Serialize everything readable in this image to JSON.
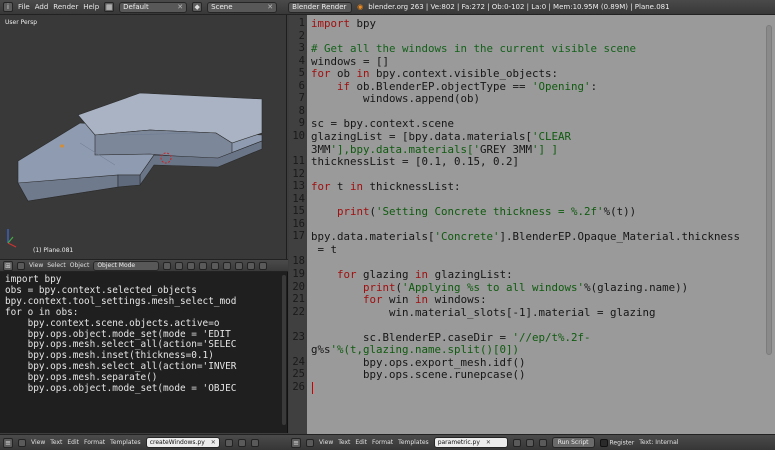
{
  "topbar": {
    "menu": [
      "File",
      "Add",
      "Render",
      "Help"
    ],
    "layout": "Default",
    "scene": "Scene",
    "engine": "Blender Render",
    "stats": "blender.org 263 | Ve:802 | Fa:272 | Ob:0-102 | La:0 | Mem:10.95M (0.89M) | Plane.081"
  },
  "viewport": {
    "title": "User Persp",
    "object_label": "(1) Plane.081",
    "header": {
      "menu": [
        "View",
        "Select",
        "Object"
      ],
      "mode": "Object Mode"
    }
  },
  "console": {
    "lines": [
      "import bpy",
      "obs = bpy.context.selected_objects",
      "bpy.context.tool_settings.mesh_select_mod",
      "for o in obs:",
      "    bpy.context.scene.objects.active=o",
      "    bpy.ops.object.mode_set(mode = 'EDIT",
      "    bpy.ops.mesh.select_all(action='SELEC",
      "    bpy.ops.mesh.inset(thickness=0.1)",
      "    bpy.ops.mesh.select_all(action='INVER",
      "    bpy.ops.mesh.separate()",
      "    bpy.ops.object.mode_set(mode = 'OBJEC"
    ]
  },
  "left_bottom": {
    "menu": [
      "View",
      "Text",
      "Edit",
      "Format",
      "Templates"
    ],
    "file": "createWindows.py"
  },
  "right_bottom": {
    "menu": [
      "View",
      "Text",
      "Edit",
      "Format",
      "Templates"
    ],
    "file": "parametric.py",
    "run": "Run Script",
    "register": "Register",
    "status": "Text: Internal"
  },
  "editor": {
    "rows": [
      {
        "n": "1",
        "t": "import bpy"
      },
      {
        "n": "2",
        "t": ""
      },
      {
        "n": "3",
        "t": "# Get all the windows in the current visible scene"
      },
      {
        "n": "4",
        "t": "windows = []"
      },
      {
        "n": "5",
        "t": "for ob in bpy.context.visible_objects:"
      },
      {
        "n": "6",
        "t": "    if ob.BlenderEP.objectType == 'Opening':"
      },
      {
        "n": "7",
        "t": "        windows.append(ob)"
      },
      {
        "n": "8",
        "t": ""
      },
      {
        "n": "9",
        "t": "sc = bpy.context.scene"
      },
      {
        "n": "10",
        "t": "glazingList = [bpy.data.materials['CLEAR"
      },
      {
        "n": "",
        "t": "3MM'],bpy.data.materials['GREY 3MM'] ]"
      },
      {
        "n": "11",
        "t": "thicknessList = [0.1, 0.15, 0.2]"
      },
      {
        "n": "12",
        "t": ""
      },
      {
        "n": "13",
        "t": "for t in thicknessList:"
      },
      {
        "n": "14",
        "t": ""
      },
      {
        "n": "15",
        "t": "    print('Setting Concrete thickness = %.2f'%(t))"
      },
      {
        "n": "16",
        "t": ""
      },
      {
        "n": "17",
        "t": "bpy.data.materials['Concrete'].BlenderEP.Opaque_Material.thickness"
      },
      {
        "n": "",
        "t": " = t"
      },
      {
        "n": "18",
        "t": ""
      },
      {
        "n": "19",
        "t": "    for glazing in glazingList:"
      },
      {
        "n": "20",
        "t": "        print('Applying %s to all windows'%(glazing.name))"
      },
      {
        "n": "21",
        "t": "        for win in windows:"
      },
      {
        "n": "22",
        "t": "            win.material_slots[-1].material = glazing"
      },
      {
        "n": "",
        "t": ""
      },
      {
        "n": "23",
        "t": "        sc.BlenderEP.caseDir = '//ep/t%.2f-"
      },
      {
        "n": "",
        "t": "g%s'%(t,glazing.name.split()[0])"
      },
      {
        "n": "24",
        "t": "        bpy.ops.export_mesh.idf()"
      },
      {
        "n": "25",
        "t": "        bpy.ops.scene.runepcase()"
      },
      {
        "n": "26",
        "t": ""
      }
    ]
  },
  "colors": {
    "editor_bg": "#9a9a9a",
    "keyword": "#a01010",
    "string": "#0f5a0f",
    "console_bg": "#1f1f1f",
    "viewport_bg": "#393939"
  }
}
